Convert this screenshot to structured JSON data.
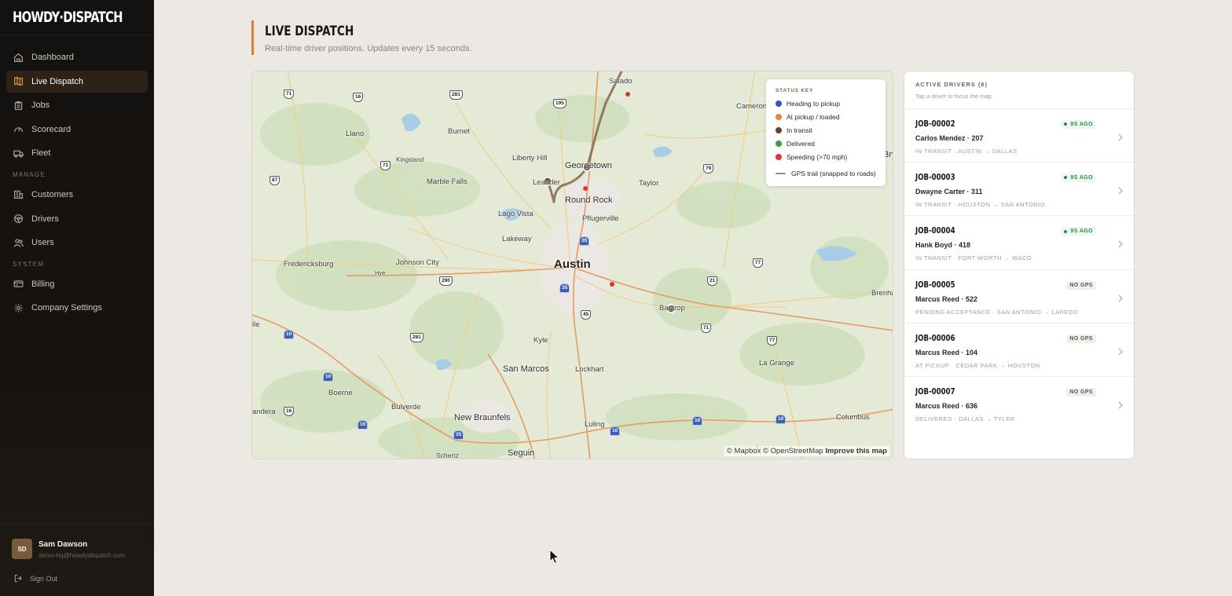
{
  "brand": {
    "name": "HOWDY·DISPATCH"
  },
  "nav": {
    "main": [
      {
        "label": "Dashboard",
        "icon": "home-icon",
        "active": false
      },
      {
        "label": "Live Dispatch",
        "icon": "map-icon",
        "active": true
      },
      {
        "label": "Jobs",
        "icon": "clipboard-icon",
        "active": false
      },
      {
        "label": "Scorecard",
        "icon": "gauge-icon",
        "active": false
      },
      {
        "label": "Fleet",
        "icon": "truck-icon",
        "active": false
      }
    ],
    "manage_label": "MANAGE",
    "manage": [
      {
        "label": "Customers",
        "icon": "building-icon"
      },
      {
        "label": "Drivers",
        "icon": "steering-icon"
      },
      {
        "label": "Users",
        "icon": "users-icon"
      }
    ],
    "system_label": "SYSTEM",
    "system": [
      {
        "label": "Billing",
        "icon": "card-icon"
      },
      {
        "label": "Company Settings",
        "icon": "gear-icon"
      }
    ]
  },
  "user": {
    "initials": "SD",
    "name": "Sam Dawson",
    "email": "demo-hq@howdydispatch.com",
    "signout": "Sign Out"
  },
  "header": {
    "title": "LIVE DISPATCH",
    "subtitle": "Real-time driver positions. Updates every 15 seconds."
  },
  "map": {
    "legend": {
      "title": "STATUS KEY",
      "items": [
        {
          "label": "Heading to pickup",
          "color": "#3f4fc9"
        },
        {
          "label": "At pickup / loaded",
          "color": "#e0873a"
        },
        {
          "label": "In transit",
          "color": "#5e4530"
        },
        {
          "label": "Delivered",
          "color": "#3d9a4e"
        },
        {
          "label": "Speeding (>70 mph)",
          "color": "#d43a35"
        }
      ],
      "trail_label": "GPS trail (snapped to roads)"
    },
    "cities": {
      "salado": "Salado",
      "cameron": "Cameron",
      "llano": "Llano",
      "burnet": "Burnet",
      "kingsland": "Kingsland",
      "liberty_hill": "Liberty Hill",
      "georgetown": "Georgetown",
      "marble_falls": "Marble Falls",
      "leander": "Leander",
      "taylor": "Taylor",
      "round_rock": "Round Rock",
      "lago_vista": "Lago Vista",
      "pflugerville": "Pflugerville",
      "lakeway": "Lakeway",
      "fredericksburg": "Fredericksburg",
      "johnson_city": "Johnson City",
      "hye": "Hye",
      "austin": "Austin",
      "bastrop": "Bastrop",
      "brenham": "Brenham",
      "kyle": "Kyle",
      "la_grange": "La Grange",
      "san_marcos": "San Marcos",
      "lockhart": "Lockhart",
      "boerne": "Boerne",
      "bulverde": "Bulverde",
      "new_braunfels": "New Braunfels",
      "luling": "Luling",
      "columbus": "Columbus",
      "bandera": "andera",
      "schertz": "Schertz",
      "seguin": "Seguin",
      "kerrville": "lle",
      "bryan": "Bry"
    },
    "highways": [
      "71",
      "16",
      "281",
      "195",
      "87",
      "71",
      "79",
      "35",
      "77",
      "290",
      "35",
      "21",
      "10",
      "281",
      "45",
      "71",
      "77",
      "10",
      "16",
      "10",
      "35",
      "10",
      "10",
      "10"
    ],
    "attribution": {
      "mapbox": "© Mapbox",
      "osm": "© OpenStreetMap",
      "improve": "Improve this map"
    }
  },
  "drivers_panel": {
    "title": "ACTIVE DRIVERS (6)",
    "hint": "Tap a driver to focus the map.",
    "drivers": [
      {
        "job": "JOB-00002",
        "name": "Carlos Mendez · 207",
        "route": "IN TRANSIT · AUSTIN → DALLAS",
        "badge": "9S AGO",
        "badge_type": "ok"
      },
      {
        "job": "JOB-00003",
        "name": "Dwayne Carter · 311",
        "route": "IN TRANSIT · HOUSTON → SAN ANTONIO",
        "badge": "9S AGO",
        "badge_type": "ok"
      },
      {
        "job": "JOB-00004",
        "name": "Hank Boyd · 418",
        "route": "IN TRANSIT · FORT WORTH → WACO",
        "badge": "9S AGO",
        "badge_type": "ok"
      },
      {
        "job": "JOB-00005",
        "name": "Marcus Reed · 522",
        "route": "PENDING ACCEPTANCE · SAN ANTONIO → LAREDO",
        "badge": "NO GPS",
        "badge_type": "nogps"
      },
      {
        "job": "JOB-00006",
        "name": "Marcus Reed · 104",
        "route": "AT PICKUP · CEDAR PARK → HOUSTON",
        "badge": "NO GPS",
        "badge_type": "nogps"
      },
      {
        "job": "JOB-00007",
        "name": "Marcus Reed · 636",
        "route": "DELIVERED · DALLAS → TYLER",
        "badge": "NO GPS",
        "badge_type": "nogps"
      }
    ]
  }
}
